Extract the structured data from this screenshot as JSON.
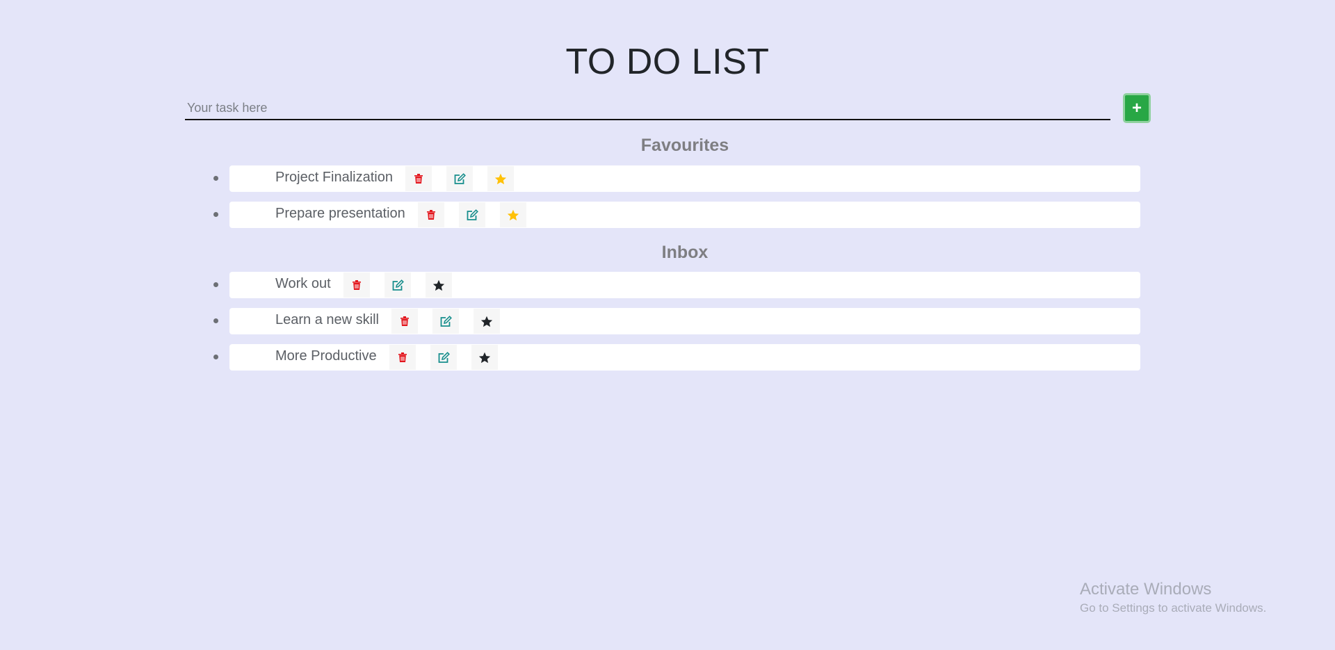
{
  "header": {
    "title": "TO DO LIST"
  },
  "new_task": {
    "placeholder": "Your task here",
    "value": "",
    "add_label": "+"
  },
  "favourites": {
    "heading": "Favourites",
    "items": [
      {
        "text": "Project Finalization",
        "starred": true
      },
      {
        "text": "Prepare presentation",
        "starred": true
      }
    ]
  },
  "inbox": {
    "heading": "Inbox",
    "items": [
      {
        "text": "Work out",
        "starred": false
      },
      {
        "text": "Learn a new skill",
        "starred": false
      },
      {
        "text": "More Productive",
        "starred": false
      }
    ]
  },
  "icons": {
    "delete": "trash-icon",
    "edit": "edit-icon",
    "favourite": "star-icon"
  },
  "colors": {
    "background": "#e4e5f9",
    "add_button": "#28a745",
    "delete_icon": "#e3161d",
    "edit_icon": "#178e8c",
    "star_active": "#ffc107",
    "star_inactive": "#212529"
  },
  "watermark": {
    "title": "Activate Windows",
    "subtitle": "Go to Settings to activate Windows."
  }
}
